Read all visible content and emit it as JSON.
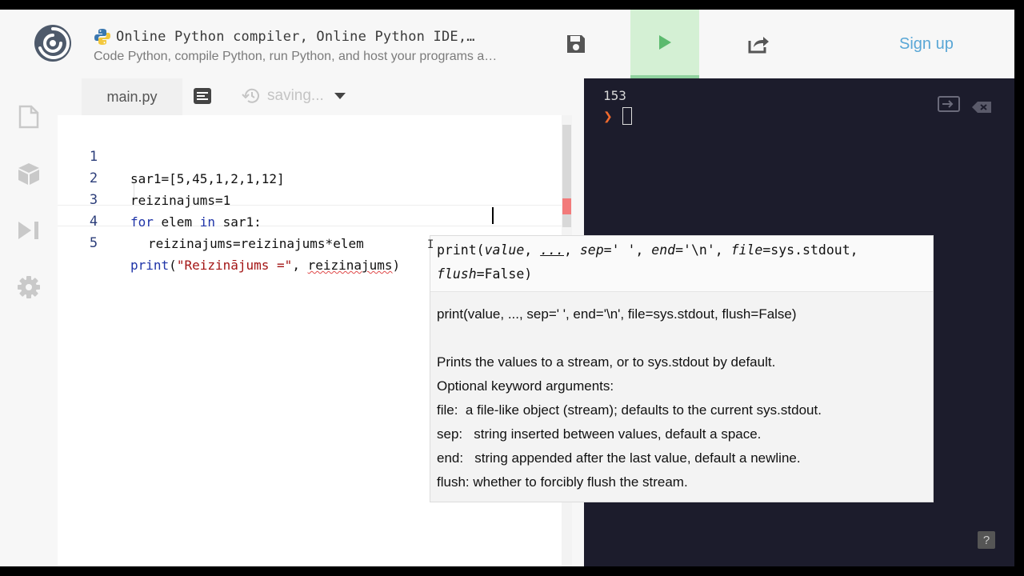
{
  "header": {
    "title": "Online Python compiler, Online Python IDE,…",
    "subtitle": "Code Python, compile Python, run Python, and host your programs a…",
    "signup_label": "Sign up"
  },
  "editor": {
    "tab_label": "main.py",
    "saving_label": "saving...",
    "lines": [
      {
        "num": "1",
        "text": "sar1=[5,45,1,2,1,12]"
      },
      {
        "num": "2",
        "text": "reizinajums=1"
      },
      {
        "num": "3",
        "kw1": "for",
        "mid1": " elem ",
        "kw2": "in",
        "mid2": " sar1:"
      },
      {
        "num": "4",
        "text": "reizinajums=reizinajums*elem"
      },
      {
        "num": "5",
        "kw": "print",
        "open": "(",
        "str": "\"Reizinājums =\"",
        "sep": ", ",
        "arg": "reizinajums",
        "close": ")"
      }
    ]
  },
  "console": {
    "output": "153",
    "prompt_symbol": "❯",
    "help": "?"
  },
  "tooltip": {
    "sig1_a": "print(",
    "sig1_value": "value",
    "sig1_b": ", ",
    "sig1_dots": "...",
    "sig1_c": ", ",
    "sig1_sep": "sep",
    "sig1_d": "=' ', ",
    "sig1_end": "end",
    "sig1_e": "='\\n', ",
    "sig1_file": "file",
    "sig1_f": "=sys.stdout,",
    "sig2_flush": "flush",
    "sig2_b": "=False)",
    "doc": [
      "print(value, ..., sep=' ', end='\\n', file=sys.stdout, flush=False)",
      "",
      "Prints the values to a stream, or to sys.stdout by default.",
      "Optional keyword arguments:",
      "file:  a file-like object (stream); defaults to the current sys.stdout.",
      "sep:   string inserted between values, default a space.",
      "end:   string appended after the last value, default a newline.",
      "flush: whether to forcibly flush the stream."
    ]
  },
  "colors": {
    "accent": "#5aa7d6",
    "run_bg": "#d4f0d4",
    "console_bg": "#1c1c2c",
    "prompt": "#f06a2e"
  }
}
